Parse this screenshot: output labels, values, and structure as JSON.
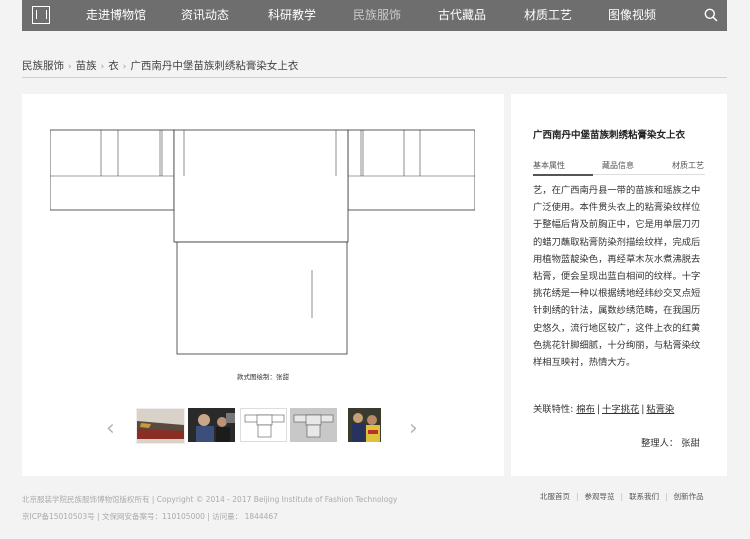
{
  "nav": {
    "items": [
      "走进博物馆",
      "资讯动态",
      "科研教学",
      "民族服饰",
      "古代藏品",
      "材质工艺",
      "图像视频"
    ],
    "active_index": 3
  },
  "breadcrumb": {
    "items": [
      "民族服饰",
      "苗族",
      "衣",
      "广西南丹中堡苗族刺绣粘膏染女上衣"
    ]
  },
  "gallery": {
    "caption": "款式图绘制：张甜",
    "prev_icon": "chevron-left-icon",
    "next_icon": "chevron-right-icon"
  },
  "detail": {
    "title": "广西南丹中堡苗族刺绣粘膏染女上衣",
    "tabs": [
      "基本属性",
      "藏品信息",
      "材质工艺"
    ],
    "active_tab": 0,
    "description": "艺，在广西南丹县一带的苗族和瑶族之中广泛使用。本件贯头衣上的粘膏染纹样位于整幅后背及前胸正中，它是用单层刀刃的蜡刀蘸取粘膏防染剂描绘纹样，完成后用植物蓝靛染色，再经草木灰水煮沸脱去粘膏，便会呈现出蓝白相间的纹样。十字挑花绣是一种以根据绣地经纬纱交叉点短针刺绣的针法，属数纱绣范畴，在我国历史悠久，流行地区较广，这件上衣的红黄色挑花针脚细腻，十分绚丽，与粘膏染纹样相互映衬，热情大方。",
    "related_label": "关联特性:",
    "related_links": [
      "棉布",
      "十字挑花",
      "粘膏染"
    ],
    "editor": "整理人：  张甜"
  },
  "footer": {
    "line1": "北京服装学院民族服饰博物馆版权所有  |  Copyright © 2014 - 2017 Beijing Institute of Fashion Technology",
    "line2": "京ICP备15010503号  |  文保网安备案号：110105000  |  访问量：  1844467",
    "links": [
      "北服首页",
      "参观导览",
      "联系我们",
      "创新作品"
    ]
  }
}
